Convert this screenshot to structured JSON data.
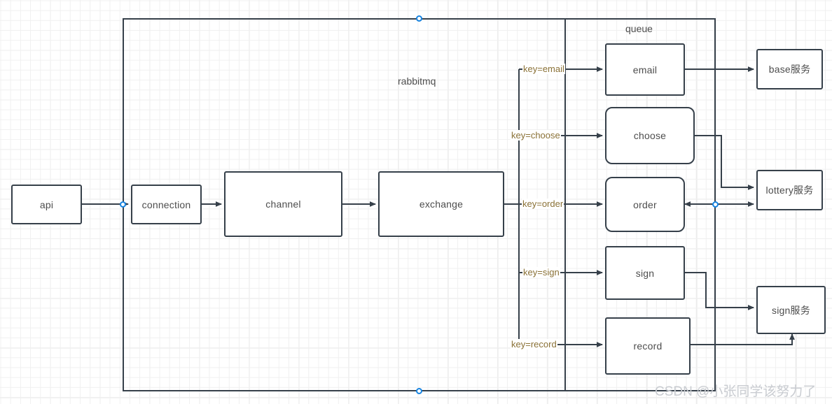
{
  "diagram": {
    "title_label": "rabbitmq",
    "queue_label": "queue",
    "watermark": "CSDN @小张同学该努力了",
    "colors": {
      "stroke": "#36404a",
      "text": "#4d4d4d",
      "key_text": "#8a7136",
      "handle": "#1683e0",
      "grid_minor": "#f0f0f0",
      "grid_major": "#e6e6e6",
      "watermark": "#c9ccd1"
    }
  },
  "nodes": {
    "api": "api",
    "connection": "connection",
    "channel": "channel",
    "exchange": "exchange",
    "queue_email": "email",
    "queue_choose": "choose",
    "queue_order": "order",
    "queue_sign": "sign",
    "queue_record": "record",
    "service_base": "base服务",
    "service_lottery": "lottery服务",
    "service_sign": "sign服务"
  },
  "routing_keys": [
    {
      "id": "email",
      "label": "key=email"
    },
    {
      "id": "choose",
      "label": "key=choose"
    },
    {
      "id": "order",
      "label": "key=order"
    },
    {
      "id": "sign",
      "label": "key=sign"
    },
    {
      "id": "record",
      "label": "key=record"
    }
  ]
}
